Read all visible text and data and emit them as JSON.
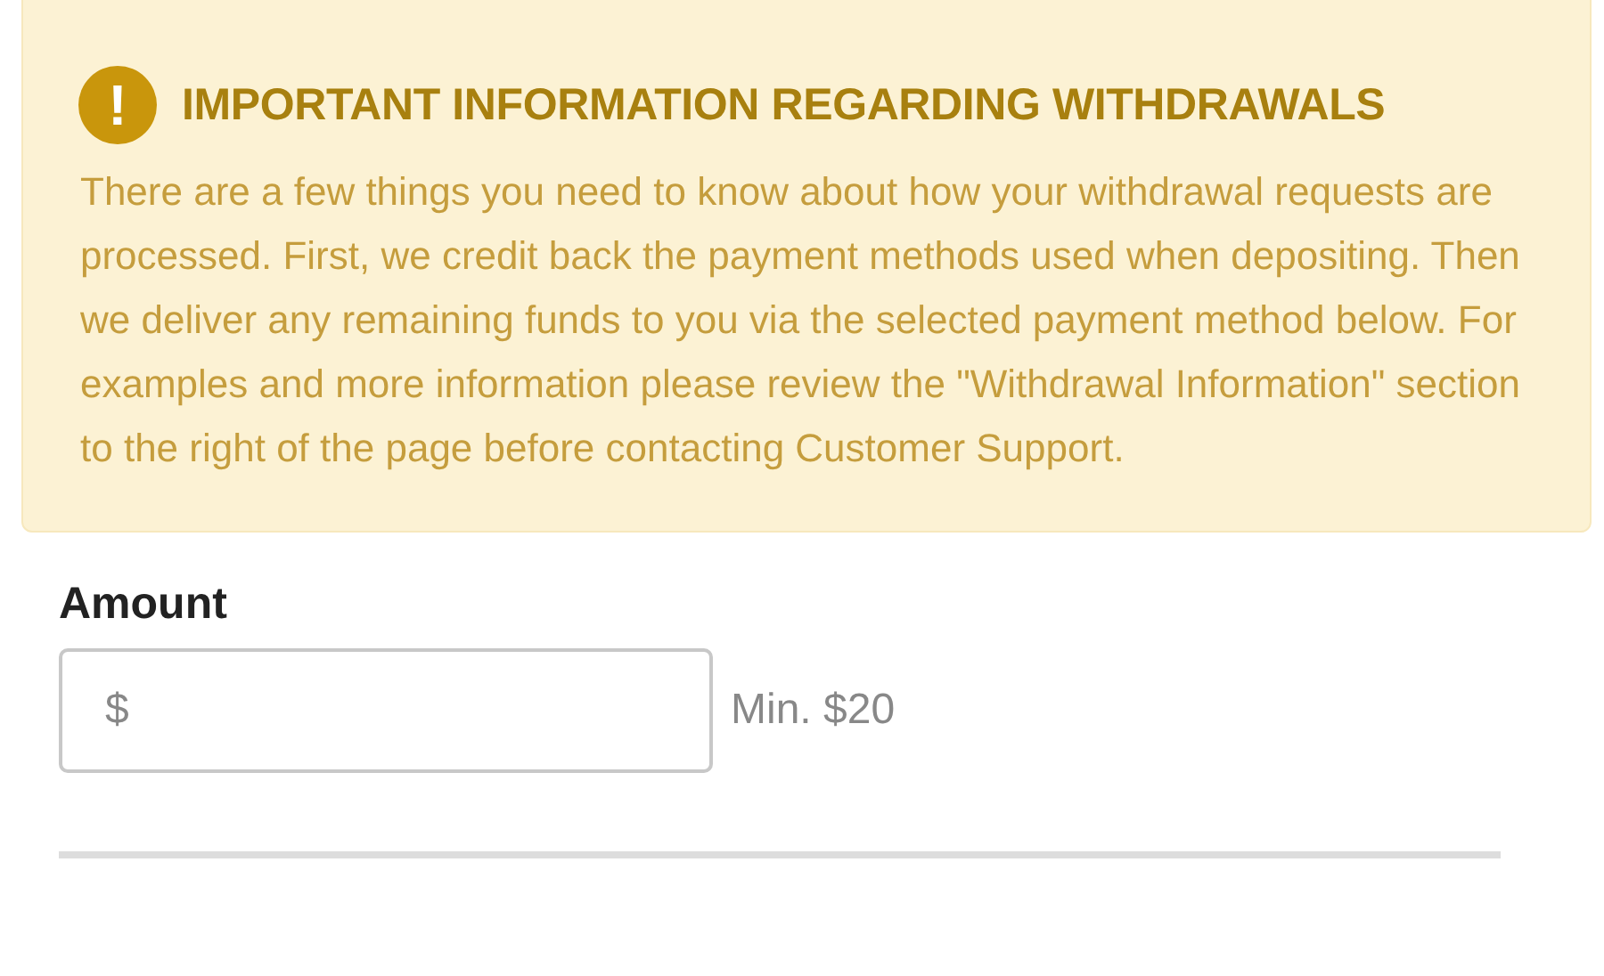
{
  "notice": {
    "title": "IMPORTANT INFORMATION REGARDING WITHDRAWALS",
    "icon_text": "!",
    "body": "There are a few things you need to know about how your withdrawal requests are processed. First, we credit back the payment methods used when depositing. Then we deliver any remaining funds to you via the selected payment method below. For examples and more information please review the \"Withdrawal Information\" section to the right of the page before contacting Customer Support."
  },
  "amount": {
    "label": "Amount",
    "placeholder": "$",
    "hint": "Min. $20"
  }
}
